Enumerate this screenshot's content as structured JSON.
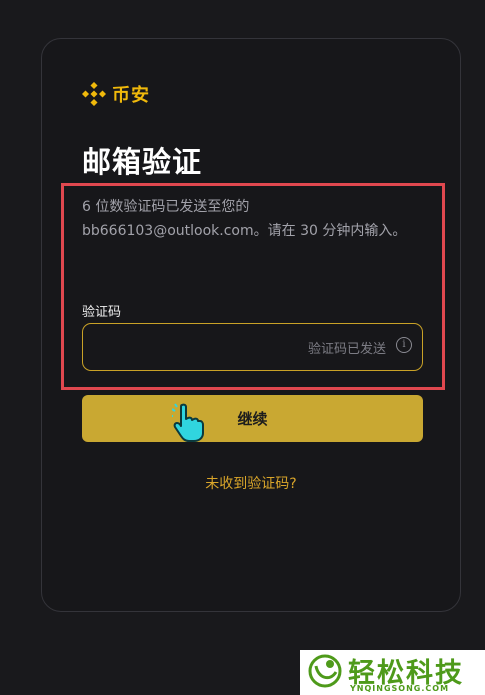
{
  "brand": {
    "name": "币安",
    "color": "#f0b90b",
    "icon": "binance-logo-icon"
  },
  "page": {
    "title": "邮箱验证",
    "description": "6 位数验证码已发送至您的 bb666103@outlook.com。请在 30 分钟内输入。"
  },
  "form": {
    "code_label": "验证码",
    "code_value": "",
    "code_status": "验证码已发送",
    "info_icon": "info-icon"
  },
  "actions": {
    "continue_label": "继续",
    "resend_link": "未收到验证码?"
  },
  "watermark": {
    "text": "轻松科技",
    "subtext": "YNQINGSONG.COM"
  },
  "colors": {
    "accent": "#f0b90b",
    "button": "#c9a832",
    "highlight": "#e0484f"
  }
}
